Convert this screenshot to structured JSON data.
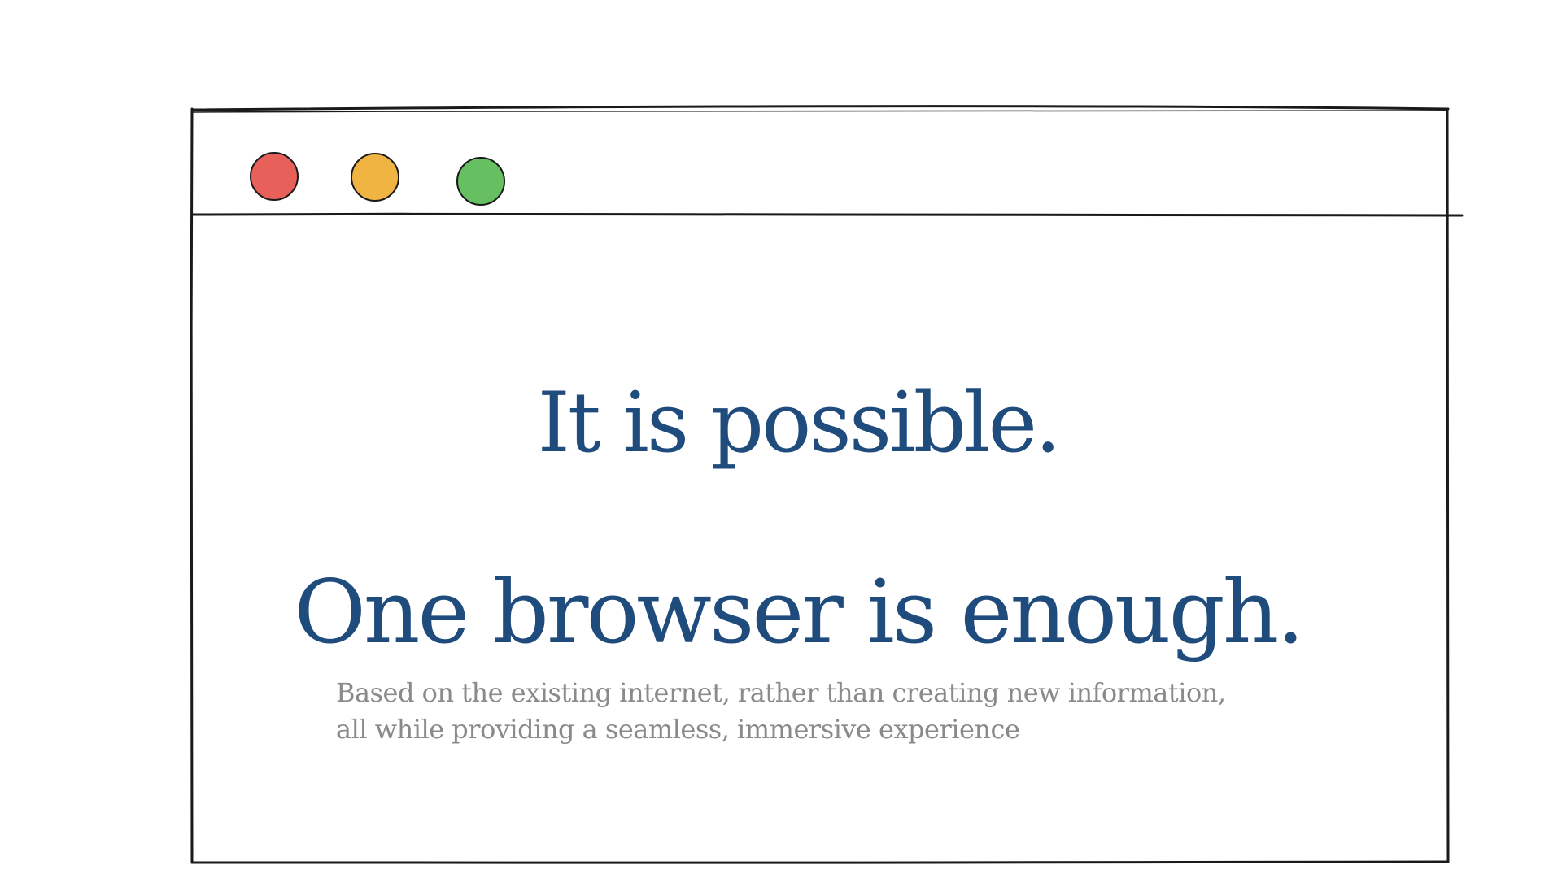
{
  "colors": {
    "headline": "#1f4c7c",
    "subtitle": "#8a8a8a",
    "stroke": "#1a1a1a",
    "close": "#e8605a",
    "minimize": "#f0b443",
    "maximize": "#66bf61"
  },
  "window": {
    "controls": [
      {
        "name": "close",
        "icon": "red-circle"
      },
      {
        "name": "minimize",
        "icon": "yellow-circle"
      },
      {
        "name": "maximize",
        "icon": "green-circle"
      }
    ]
  },
  "hero": {
    "headline_1": "It is possible.",
    "headline_2": "One browser is enough.",
    "subtitle_line_1": "Based on the existing internet, rather than creating new information,",
    "subtitle_line_2": "all while providing a seamless, immersive experience"
  }
}
